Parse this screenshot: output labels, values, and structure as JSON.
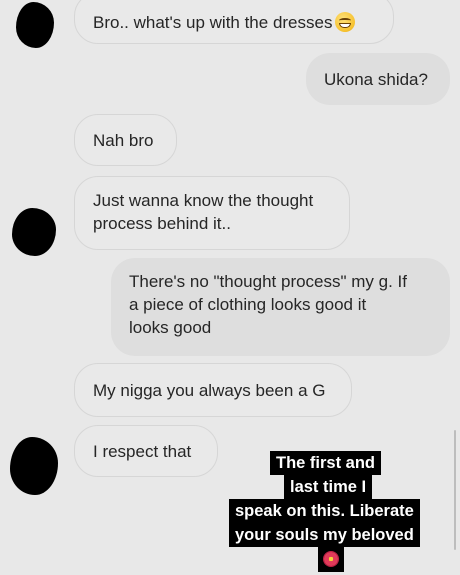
{
  "messages": [
    {
      "sender": "them",
      "text": "Bro.. what's up with the dresses",
      "emoji": "grinning-sweat-emoji"
    },
    {
      "sender": "me",
      "text": "Ukona shida?"
    },
    {
      "sender": "them",
      "text": "Nah bro"
    },
    {
      "sender": "them",
      "lines": [
        "Just wanna know the thought",
        "process behind it.."
      ]
    },
    {
      "sender": "me",
      "lines": [
        "There's no \"thought process\" my g. If",
        "a piece of clothing looks good it",
        "looks good"
      ]
    },
    {
      "sender": "them",
      "text": "My nigga you always been a G"
    },
    {
      "sender": "them",
      "text": "I respect that"
    }
  ],
  "story_caption": {
    "lines": [
      "The first and",
      "last time I",
      "speak on this. Liberate",
      "your souls my beloved"
    ],
    "emoji": "hibiscus-emoji"
  },
  "colors": {
    "background": "#e8e8e8",
    "incoming_bubble": "#e9e9e9",
    "outgoing_bubble": "#dedede",
    "caption_bg": "#000000",
    "caption_text": "#ffffff"
  }
}
